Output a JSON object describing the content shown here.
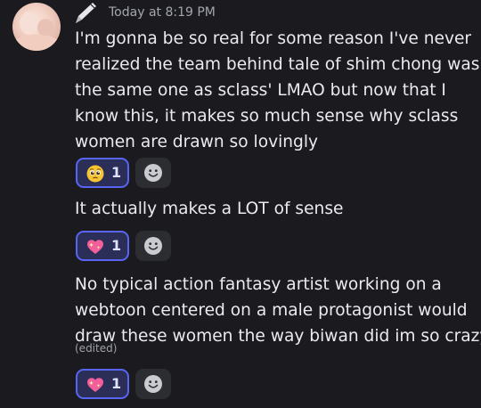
{
  "message": {
    "timestamp": "Today at 8:19 PM",
    "lines": {
      "m1": [
        "I'm gonna be so real for some reason I've never",
        "realized the team behind tale of shim chong was",
        "the same one as sclass' LMAO but now that I",
        "know this, it makes so much sense why sclass",
        "women are drawn so lovingly"
      ],
      "m2": [
        "It actually makes a LOT of sense"
      ],
      "m3": [
        "No typical action fantasy artist working on a",
        "webtoon centered on a male protagonist would",
        "draw these women the way biwan did im so crazy"
      ]
    },
    "edited_label": "(edited)"
  },
  "reactions": [
    {
      "emoji": "pleading-face-icon",
      "count": "1"
    },
    {
      "emoji": "sparkling-heart-icon",
      "count": "1"
    },
    {
      "emoji": "sparkling-heart-icon",
      "count": "1"
    }
  ],
  "colors": {
    "background": "#1b1b1f",
    "reaction_border": "#5865f2",
    "reaction_bg": "#2b2f58",
    "text": "#eaeaef",
    "muted": "#a3a6ad"
  }
}
